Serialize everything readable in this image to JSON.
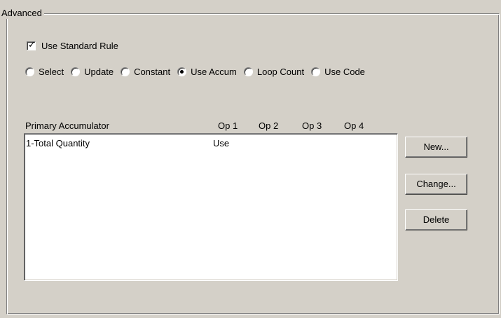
{
  "group": {
    "title": "Advanced"
  },
  "standard_rule": {
    "label": "Use Standard Rule",
    "checked": true
  },
  "modes": [
    {
      "label": "Select",
      "selected": false
    },
    {
      "label": "Update",
      "selected": false
    },
    {
      "label": "Constant",
      "selected": false
    },
    {
      "label": "Use Accum",
      "selected": true
    },
    {
      "label": "Loop Count",
      "selected": false
    },
    {
      "label": "Use Code",
      "selected": false
    }
  ],
  "accumulator_list": {
    "columns": [
      "Primary Accumulator",
      "Op 1",
      "Op 2",
      "Op 3",
      "Op 4"
    ],
    "rows": [
      {
        "primary": "1-Total Quantity",
        "op1": "Use",
        "op2": "",
        "op3": "",
        "op4": ""
      }
    ]
  },
  "buttons": {
    "new_label": "New...",
    "change_label": "Change...",
    "delete_label": "Delete"
  }
}
